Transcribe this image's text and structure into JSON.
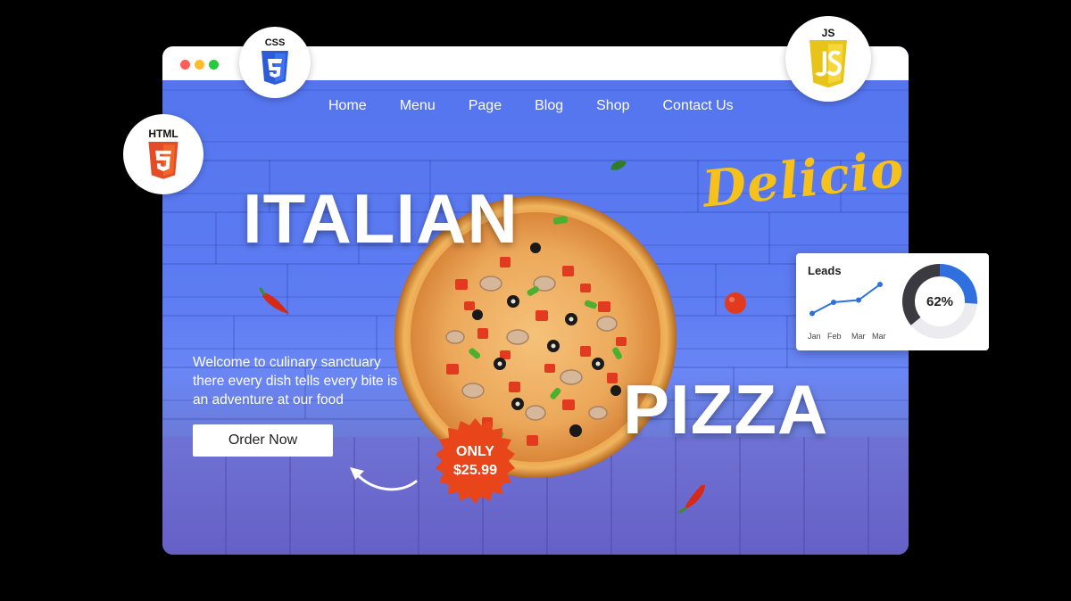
{
  "nav": {
    "items": [
      "Home",
      "Menu",
      "Page",
      "Blog",
      "Shop",
      "Contact Us"
    ]
  },
  "hero": {
    "title_top": "ITALIAN",
    "title_bottom": "PIZZA",
    "script_title": "Delicio",
    "tagline": "Welcome to culinary sanctuary there every dish tells every bite is an adventure at our food",
    "order_button": "Order Now",
    "badge_line1": "ONLY",
    "badge_line2": "$25.99"
  },
  "tech_badges": {
    "css": "CSS",
    "html": "HTML",
    "js": "JS"
  },
  "leads_card": {
    "title": "Leads",
    "months": [
      "Jan",
      "Feb",
      "Mar",
      "Mar"
    ],
    "values": [
      1,
      2,
      2.2,
      3.6
    ],
    "donut_percent": "62%",
    "donut_value": 0.62
  },
  "colors": {
    "brand_blue": "#5b7cf0",
    "badge_red": "#e8451b",
    "script_yellow": "#f5c11a",
    "chart_blue": "#2f6fe0"
  },
  "icons": [
    "css3-icon",
    "html5-icon",
    "js-icon",
    "curved-arrow-icon",
    "chili-icon",
    "tomato-icon",
    "basil-leaf-icon"
  ]
}
